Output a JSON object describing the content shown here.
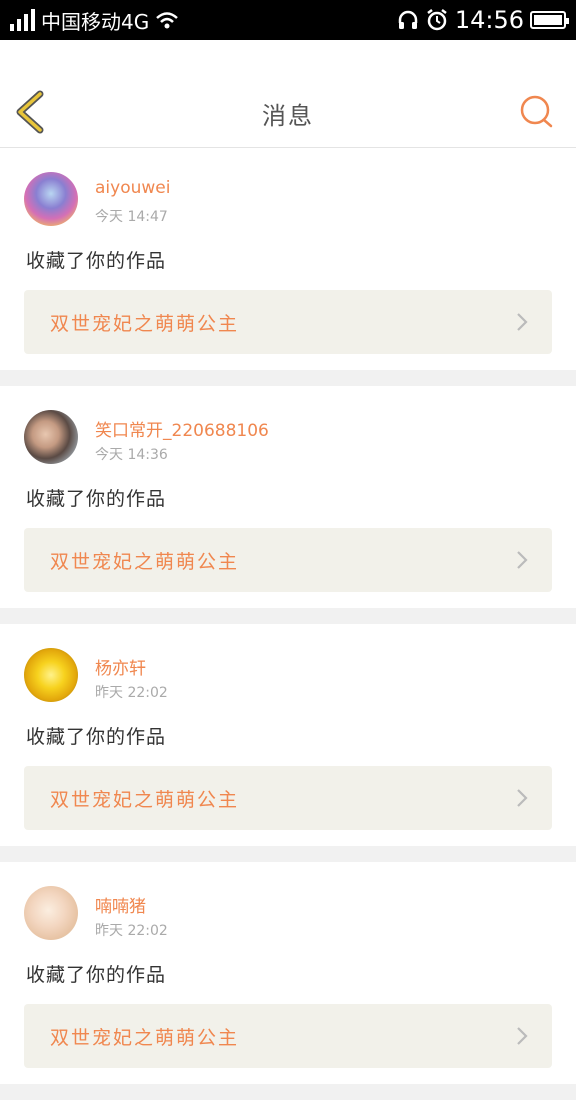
{
  "status_bar": {
    "carrier": "中国移动4G",
    "time": "14:56"
  },
  "header": {
    "title": "消息"
  },
  "messages": [
    {
      "username": "aiyouwei",
      "time": "今天 14:47",
      "action": "收藏了你的作品",
      "work_title": "双世宠妃之萌萌公主"
    },
    {
      "username": "笑口常开_220688106",
      "time": "今天 14:36",
      "action": "收藏了你的作品",
      "work_title": "双世宠妃之萌萌公主"
    },
    {
      "username": "杨亦轩",
      "time": "昨天 22:02",
      "action": "收藏了你的作品",
      "work_title": "双世宠妃之萌萌公主"
    },
    {
      "username": "喃喃猪",
      "time": "昨天 22:02",
      "action": "收藏了你的作品",
      "work_title": "双世宠妃之萌萌公主"
    }
  ],
  "colors": {
    "accent": "#f0874f",
    "card_link_bg": "#f2f1ea",
    "back_arrow": "#c9a227"
  }
}
